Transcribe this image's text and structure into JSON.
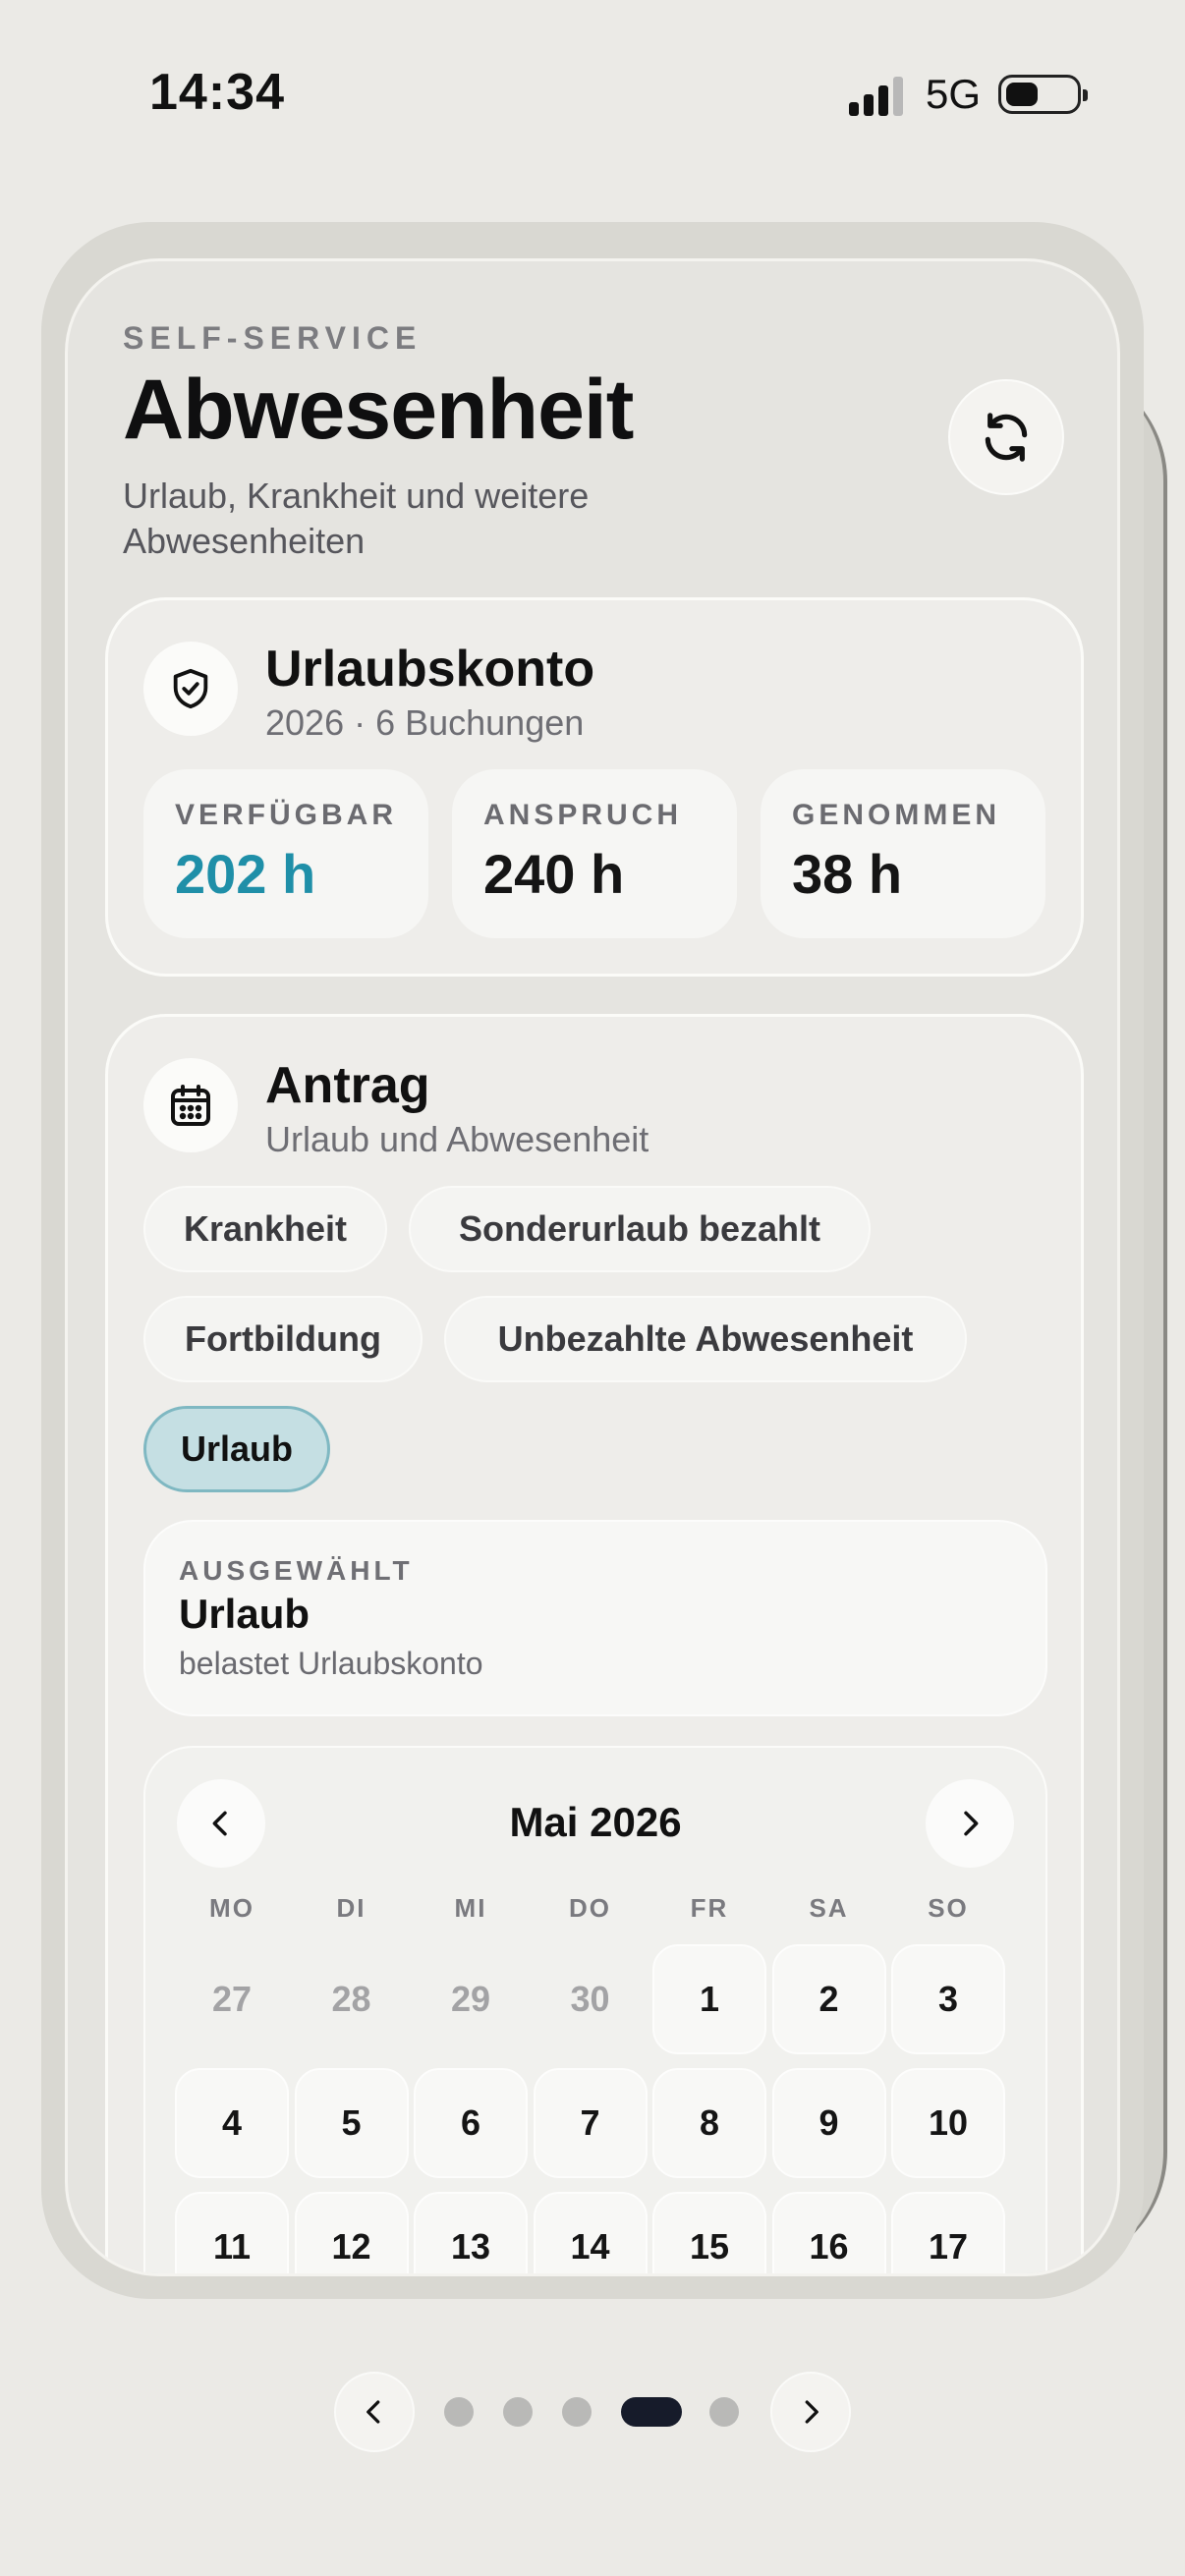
{
  "status_bar": {
    "time": "14:34",
    "network": "5G"
  },
  "header": {
    "eyebrow": "SELF-SERVICE",
    "title": "Abwesenheit",
    "subtitle": "Urlaub, Krankheit und weitere Abwesenheiten",
    "refresh_icon": "refresh-icon"
  },
  "account": {
    "icon": "shield-check-icon",
    "title": "Urlaubskonto",
    "subtitle": "2026 · 6 Buchungen",
    "stats": [
      {
        "label": "VERFÜGBAR",
        "value": "202 h",
        "color": "#1f8fa8"
      },
      {
        "label": "ANSPRUCH",
        "value": "240 h",
        "color": "#151515"
      },
      {
        "label": "GENOMMEN",
        "value": "38 h",
        "color": "#151515"
      }
    ]
  },
  "request": {
    "icon": "calendar-icon",
    "title": "Antrag",
    "subtitle": "Urlaub und Abwesenheit",
    "types": [
      "Krankheit",
      "Sonderurlaub bezahlt",
      "Fortbildung",
      "Unbezahlte Abwesenheit",
      "Urlaub"
    ],
    "active_type": "Urlaub",
    "selected": {
      "label": "AUSGEWÄHLT",
      "value": "Urlaub",
      "hint": "belastet Urlaubskonto"
    }
  },
  "calendar": {
    "month": "Mai 2026",
    "weekdays": [
      "MO",
      "DI",
      "MI",
      "DO",
      "FR",
      "SA",
      "SO"
    ],
    "days": [
      {
        "d": "27",
        "out": true
      },
      {
        "d": "28",
        "out": true
      },
      {
        "d": "29",
        "out": true
      },
      {
        "d": "30",
        "out": true
      },
      {
        "d": "1",
        "out": false
      },
      {
        "d": "2",
        "out": false
      },
      {
        "d": "3",
        "out": false
      },
      {
        "d": "4",
        "out": false
      },
      {
        "d": "5",
        "out": false
      },
      {
        "d": "6",
        "out": false
      },
      {
        "d": "7",
        "out": false
      },
      {
        "d": "8",
        "out": false
      },
      {
        "d": "9",
        "out": false
      },
      {
        "d": "10",
        "out": false
      },
      {
        "d": "11",
        "out": false
      },
      {
        "d": "12",
        "out": false
      },
      {
        "d": "13",
        "out": false
      },
      {
        "d": "14",
        "out": false
      },
      {
        "d": "15",
        "out": false
      },
      {
        "d": "16",
        "out": false
      },
      {
        "d": "17",
        "out": false
      }
    ]
  },
  "pager": {
    "pages": 5,
    "active_index": 3
  }
}
